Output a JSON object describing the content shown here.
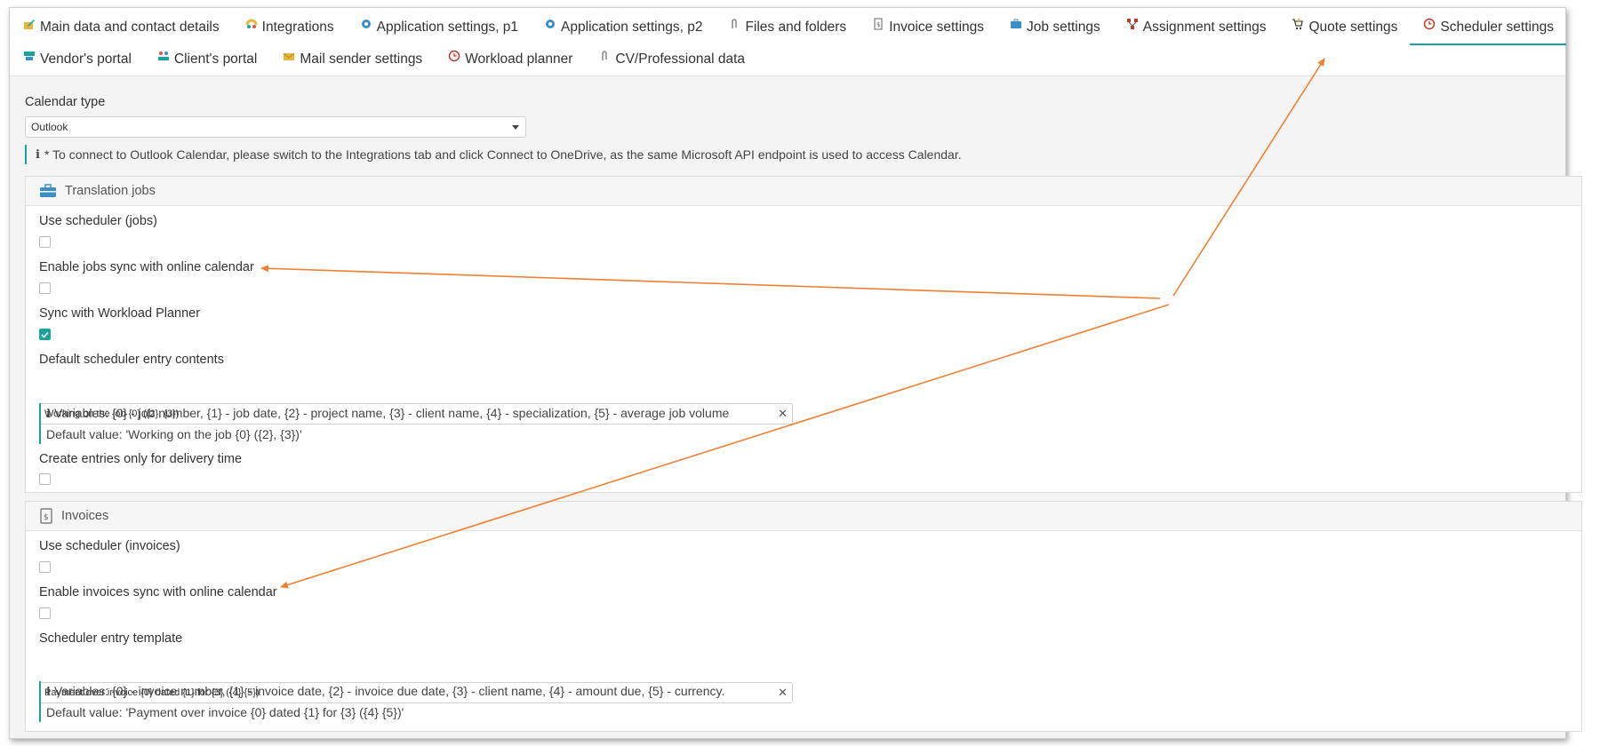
{
  "tabs_row1": [
    {
      "label": "Main data and contact details",
      "icon": "edit-icon",
      "active": false
    },
    {
      "label": "Integrations",
      "icon": "integrations-icon",
      "active": false
    },
    {
      "label": "Application settings, p1",
      "icon": "gear-icon",
      "active": false
    },
    {
      "label": "Application settings, p2",
      "icon": "gear-icon",
      "active": false
    },
    {
      "label": "Files and folders",
      "icon": "paperclip-icon",
      "active": false
    },
    {
      "label": "Invoice settings",
      "icon": "invoice-icon",
      "active": false
    },
    {
      "label": "Job settings",
      "icon": "briefcase-icon",
      "active": false
    },
    {
      "label": "Assignment settings",
      "icon": "sitemap-icon",
      "active": false
    },
    {
      "label": "Quote settings",
      "icon": "cart-icon",
      "active": false
    },
    {
      "label": "Scheduler settings",
      "icon": "clock-icon",
      "active": true
    }
  ],
  "tabs_row2": [
    {
      "label": "Vendor's portal",
      "icon": "vendor-icon",
      "active": false
    },
    {
      "label": "Client's portal",
      "icon": "client-icon",
      "active": false
    },
    {
      "label": "Mail sender settings",
      "icon": "mail-icon",
      "active": false
    },
    {
      "label": "Workload planner",
      "icon": "clock-icon",
      "active": false
    },
    {
      "label": "CV/Professional data",
      "icon": "paperclip-icon",
      "active": false
    }
  ],
  "calendar": {
    "label": "Calendar type",
    "value": "Outlook",
    "note": "* To connect to Outlook Calendar, please switch to the Integrations tab and click Connect to OneDrive, as the same Microsoft API endpoint is used to access Calendar."
  },
  "jobs": {
    "title": "Translation jobs",
    "use_scheduler": {
      "label": "Use scheduler (jobs)",
      "checked": false
    },
    "enable_sync": {
      "label": "Enable jobs sync with online calendar",
      "checked": false
    },
    "sync_workload": {
      "label": "Sync with Workload Planner",
      "checked": true
    },
    "contents": {
      "label": "Default scheduler entry contents",
      "value": "Working on the job {0} ({2}, {3})",
      "hint1": "Variables: {0} - job number, {1} - job date, {2} - project name, {3} - client name, {4} - specialization, {5} - average job volume",
      "hint2": "Default value: 'Working on the job {0} ({2}, {3})'"
    },
    "delivery_only": {
      "label": "Create entries only for delivery time",
      "checked": false
    }
  },
  "invoices": {
    "title": "Invoices",
    "use_scheduler": {
      "label": "Use scheduler (invoices)",
      "checked": false
    },
    "enable_sync": {
      "label": "Enable invoices sync with online calendar",
      "checked": false
    },
    "template": {
      "label": "Scheduler entry template",
      "value": "Payment over invoice {0} dated {1} for {3} ({4} {5})",
      "hint1": "Variables: {0} - invoice number, {1} - invoice date, {2} - invoice due date, {3} - client name, {4} - amount due, {5} - currency.",
      "hint2": "Default value: 'Payment over invoice {0} dated {1} for {3} ({4} {5})'"
    }
  },
  "colors": {
    "accent": "#1aa39c",
    "annotation": "#f08030"
  }
}
